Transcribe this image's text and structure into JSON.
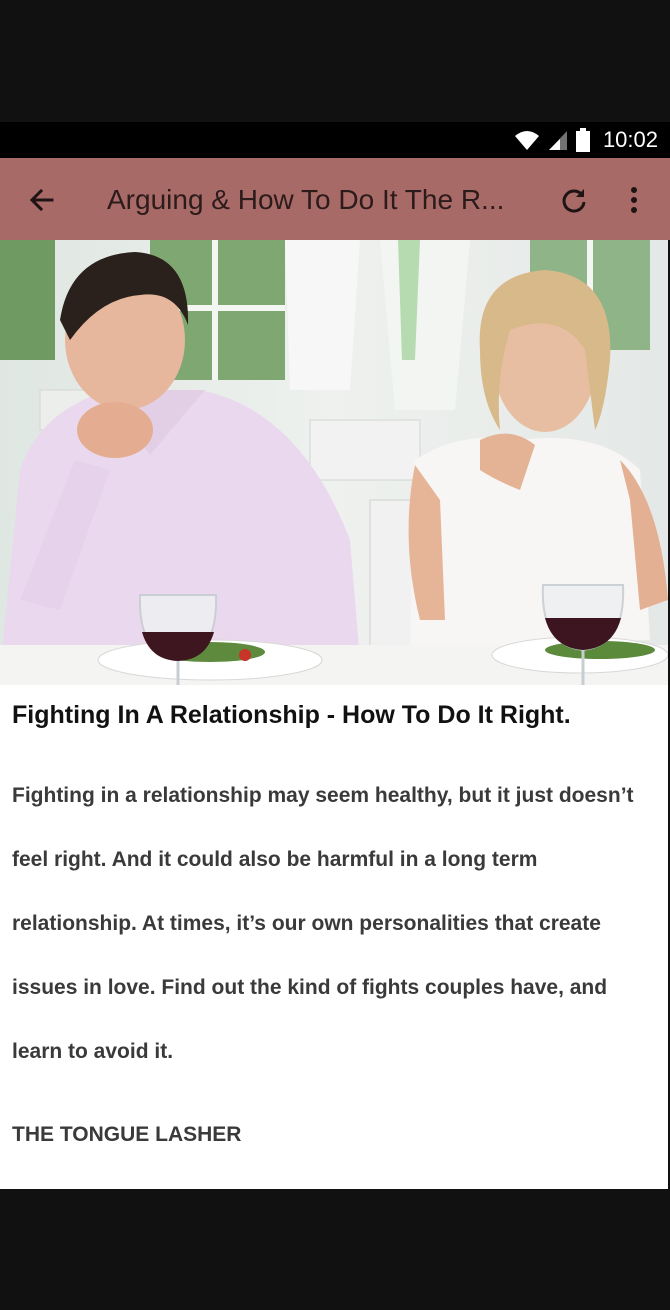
{
  "status_bar": {
    "time": "10:02",
    "icons": [
      "wifi-icon",
      "cell-signal-icon",
      "battery-icon"
    ]
  },
  "app_bar": {
    "title": "Arguing & How To Do It The R...",
    "back_icon": "arrow-back-icon",
    "refresh_icon": "refresh-icon",
    "menu_icon": "more-vertical-icon",
    "color": "#a86a67"
  },
  "article": {
    "image_description_icon": "couple-arguing-photo",
    "title": "Fighting In A Relationship - How To Do It Right.",
    "body": "Fighting in a relationship may seem healthy, but it just doesn’t feel right. And it could also be harmful in a long term relationship. At times, it’s our own personalities that create issues in love. Find out the kind of fights couples have, and learn to avoid it.",
    "section_heading": "THE TONGUE LASHER"
  }
}
